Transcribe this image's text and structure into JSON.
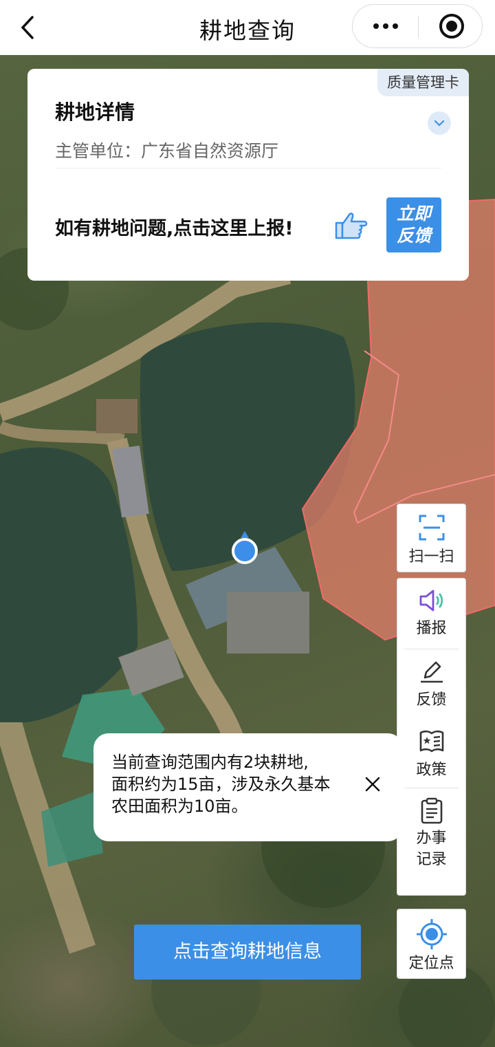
{
  "navbar": {
    "title": "耕地查询",
    "back_icon": "chevron-left-icon",
    "more_icon": "more-dots-icon",
    "close_icon": "target-close-icon"
  },
  "card": {
    "badge": "质量管理卡",
    "title": "耕地详情",
    "authority": "主管单位：广东省自然资源厅",
    "expand_icon": "chevron-down-icon",
    "report_text": "如有耕地问题,点击这里上报!",
    "report_icon": "thumb-pointer-icon",
    "feedback_button": [
      "立即",
      "反馈"
    ]
  },
  "tools": {
    "scan": {
      "icon": "scan-icon",
      "label": "扫一扫"
    },
    "broadcast": {
      "icon": "speaker-icon",
      "label": "播报"
    },
    "feedback": {
      "icon": "edit-icon",
      "label": "反馈"
    },
    "policy": {
      "icon": "policy-book-icon",
      "label": "政策"
    },
    "records": {
      "icon": "clipboard-icon",
      "label_lines": [
        "办事",
        "记录"
      ]
    },
    "locate": {
      "icon": "locate-target-icon",
      "label": "定位点"
    }
  },
  "toast": {
    "lines": [
      "当前查询范围内有2块耕地,",
      "面积约为15亩，涉及永久基本",
      "农田面积为10亩。"
    ],
    "close_icon": "close-icon"
  },
  "query_button": "点击查询耕地信息",
  "colors": {
    "accent": "#3c8fe6",
    "parcel_fill": "#e8806b",
    "parcel_stroke": "#f06a6a",
    "location_dot": "#3d8ee8"
  }
}
